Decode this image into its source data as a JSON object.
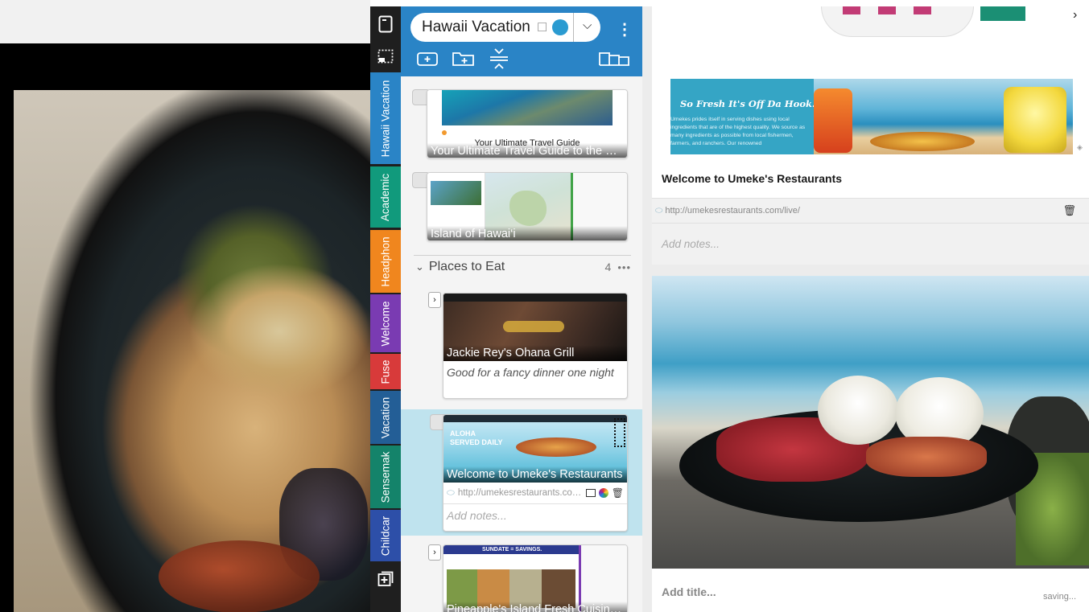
{
  "rail": {
    "tabs": [
      {
        "label": "Hawaii Vacation",
        "color": "#2a84c6"
      },
      {
        "label": "Academic",
        "color": "#119a7c"
      },
      {
        "label": "Headphon",
        "color": "#f0861e"
      },
      {
        "label": "Welcome",
        "color": "#7a3bb2"
      },
      {
        "label": "Fuse",
        "color": "#d83a3a"
      },
      {
        "label": "Vacation",
        "color": "#235e96"
      },
      {
        "label": "Sensemak",
        "color": "#14836a"
      },
      {
        "label": "Childcar",
        "color": "#2d4fa8"
      }
    ]
  },
  "panel": {
    "title": "Hawaii Vacation",
    "accent": "#2a84c6",
    "cards": [
      {
        "caption": "Your Ultimate Travel Guide to the Big I...",
        "overlay_text": "Your Ultimate Travel Guide"
      },
      {
        "caption": "Island of Hawai‘i"
      }
    ],
    "group": {
      "label": "Places to Eat",
      "count": "4",
      "more": "•••"
    },
    "group_cards": [
      {
        "caption": "Jackie Rey's Ohana Grill",
        "note": "Good for a fancy dinner one night"
      },
      {
        "caption": "Welcome to Umeke's Restaurants",
        "url": "http://umekesrestaurants.com/l...",
        "notes_placeholder": "Add notes...",
        "banner": "ALOHA SERVED DAILY"
      },
      {
        "caption": "Pineapple's Island Fresh Cuisine, H...",
        "banner": "SUNDATE = SAVINGS."
      }
    ]
  },
  "detail": {
    "banner_text": "So Fresh It's Off Da Hook!",
    "banner_sub": "Umekes prides itself in serving dishes using local ingredients that are of the highest quality. We source as many ingredients as possible from local fishermen, farmers, and ranchers. Our renowned",
    "title": "Welcome to Umeke's Restaurants",
    "url": "http://umekesrestaurants.com/live/",
    "notes_placeholder": "Add notes...",
    "title_placeholder": "Add title...",
    "status": "saving..."
  }
}
